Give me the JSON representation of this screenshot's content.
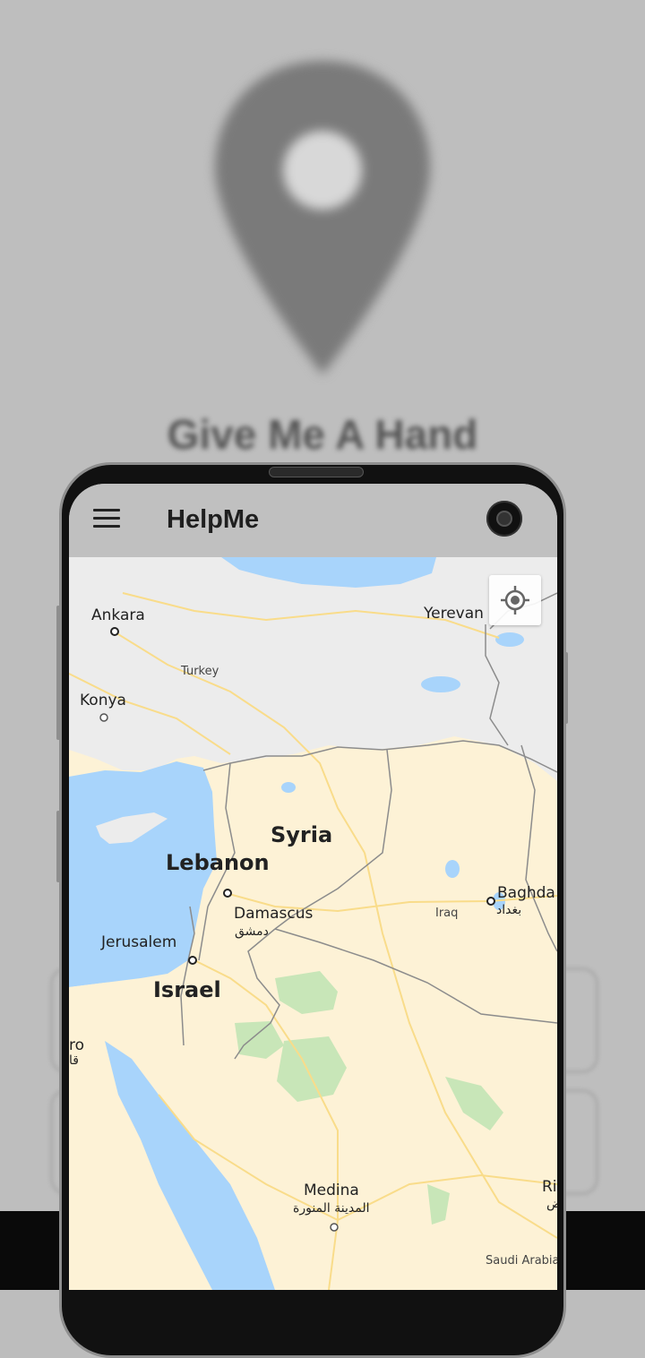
{
  "background": {
    "title": "Give Me A Hand"
  },
  "app": {
    "title": "HelpMe"
  },
  "map": {
    "labels": {
      "ankara": "Ankara",
      "yerevan": "Yerevan",
      "turkey": "Turkey",
      "konya": "Konya",
      "syria": "Syria",
      "lebanon": "Lebanon",
      "baghdad": "Baghda",
      "baghdad_ar": "بغداد",
      "damascus": "Damascus",
      "damascus_ar": "دمشق",
      "iraq": "Iraq",
      "jerusalem": "Jerusalem",
      "israel": "Israel",
      "cairo_fragment": "ro",
      "cairo_ar_fragment": "قا",
      "medina": "Medina",
      "medina_ar": "المدينة المنورة",
      "riyadh_fragment": "Riy",
      "riyadh_ar_fragment": "ض",
      "saudi_arabia": "Saudi Arabia"
    },
    "colors": {
      "water": "#a8d4fb",
      "land": "#fdf2d6",
      "north_land": "#ececec",
      "park": "#c8e6b8",
      "border": "#8c8c8c",
      "road": "#f9dc8a"
    }
  },
  "icons": {
    "menu": "menu-icon",
    "locate": "my-location-icon",
    "camera": "front-camera"
  }
}
